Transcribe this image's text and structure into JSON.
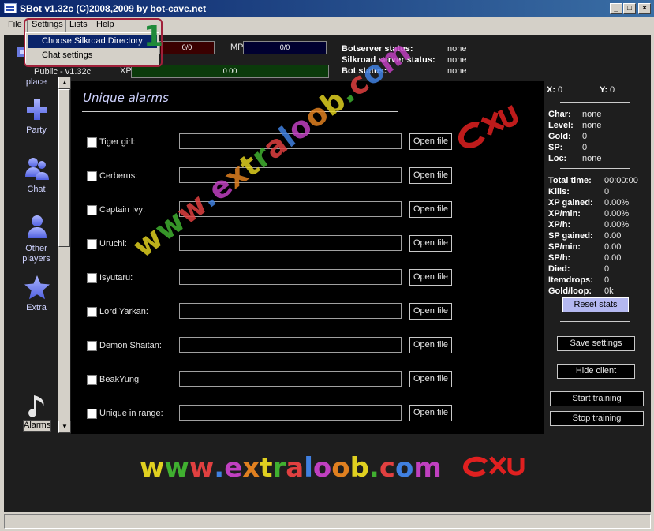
{
  "window": {
    "title": "SBot v1.32c (C)2008,2009 by bot-cave.net",
    "controls": [
      "_",
      "□",
      "×"
    ]
  },
  "menubar": [
    "File",
    "Settings",
    "Lists",
    "Help"
  ],
  "dropdown": {
    "items": [
      "Choose Silkroad Directory",
      "Chat settings"
    ],
    "highlighted": 0,
    "callout_number": "1"
  },
  "top": {
    "hp_value": "0/0",
    "mp_label": "MP",
    "mp_value": "0/0",
    "version_text": "Public - v1.32c",
    "xp_label": "XP",
    "xp_value": "0.00",
    "xp_fill": 1.0,
    "botserver_label": "Botserver status:",
    "botserver_value": "none",
    "silkroad_label": "Silkroad server status:",
    "silkroad_value": "none",
    "bot_label": "Bot status:",
    "bot_value": "none"
  },
  "leftnav": {
    "items": [
      {
        "label": "place",
        "icon": "place-icon"
      },
      {
        "label": "Party",
        "icon": "plus-icon"
      },
      {
        "label": "Chat",
        "icon": "chat-people-icon"
      },
      {
        "label": "Other",
        "label2": "players",
        "icon": "person-icon"
      },
      {
        "label": "Extra",
        "icon": "star-icon"
      },
      {
        "label": "Alarms",
        "icon": "music-note-icon"
      }
    ]
  },
  "panel": {
    "title": "Unique alarms",
    "rows": [
      {
        "label": "Tiger girl:",
        "checked": false,
        "button": "Open file"
      },
      {
        "label": "Cerberus:",
        "checked": false,
        "button": "Open file"
      },
      {
        "label": "Captain Ivy:",
        "checked": false,
        "button": "Open file"
      },
      {
        "label": "Uruchi:",
        "checked": false,
        "button": "Open file"
      },
      {
        "label": "Isyutaru:",
        "checked": false,
        "button": "Open file"
      },
      {
        "label": "Lord Yarkan:",
        "checked": false,
        "button": "Open file"
      },
      {
        "label": "Demon Shaitan:",
        "checked": false,
        "button": "Open file"
      },
      {
        "label": "BeakYung",
        "checked": false,
        "button": "Open file"
      },
      {
        "label": "Unique in range:",
        "checked": false,
        "button": "Open file"
      }
    ]
  },
  "right": {
    "x_label": "X:",
    "x_value": "0",
    "y_label": "Y:",
    "y_value": "0",
    "char_stats": [
      {
        "label": "Char:",
        "value": "none"
      },
      {
        "label": "Level:",
        "value": "none"
      },
      {
        "label": "Gold:",
        "value": "0"
      },
      {
        "label": "SP:",
        "value": "0"
      },
      {
        "label": "Loc:",
        "value": "none"
      }
    ],
    "session_stats": [
      {
        "label": "Total time:",
        "value": "00:00:00"
      },
      {
        "label": "Kills:",
        "value": "0"
      },
      {
        "label": "XP gained:",
        "value": "0.00%"
      },
      {
        "label": "XP/min:",
        "value": "0.00%"
      },
      {
        "label": "XP/h:",
        "value": "0.00%"
      },
      {
        "label": "SP gained:",
        "value": "0.00"
      },
      {
        "label": "SP/min:",
        "value": "0.00"
      },
      {
        "label": "SP/h:",
        "value": "0.00"
      },
      {
        "label": "Died:",
        "value": "0"
      },
      {
        "label": "Itemdrops:",
        "value": "0"
      },
      {
        "label": "Gold/loop:",
        "value": "0k"
      }
    ],
    "reset_label": "Reset stats",
    "save_label": "Save settings",
    "hide_label": "Hide client",
    "start_label": "Start training",
    "stop_label": "Stop training"
  },
  "watermark": {
    "text": "www.extraloob.com",
    "logo": "exu-logo",
    "colors": [
      "#e0d020",
      "#40b030",
      "#e04040",
      "#4080e0",
      "#c040c0",
      "#e08020"
    ]
  },
  "colors": {
    "titlebar": "#0a246a",
    "client_bg": "#1e1e1e",
    "panel_bg": "#000000",
    "nav_text": "#cfd3ff",
    "accent_red": "#a0203a",
    "accent_green": "#1f8a3a"
  }
}
